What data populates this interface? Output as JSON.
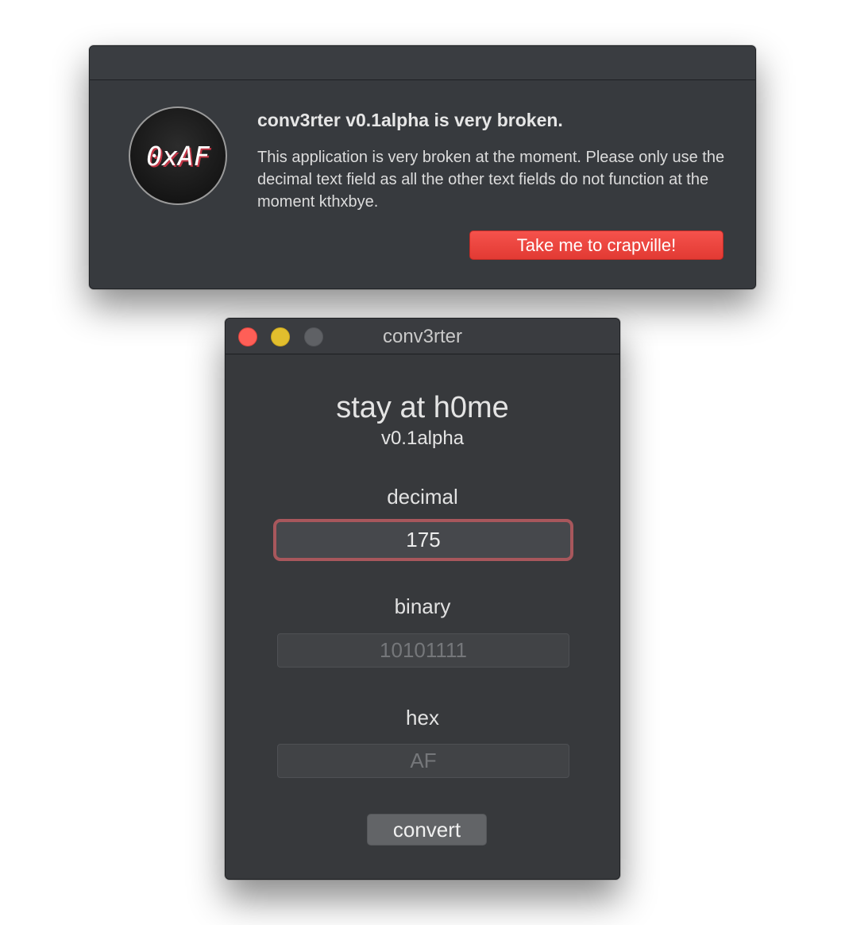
{
  "alert": {
    "icon_text": "0xAF",
    "title": "conv3rter v0.1alpha is very broken.",
    "message": "This application is very broken at the moment. Please only use the decimal text field as all the other text fields do not function at the moment kthxbye.",
    "button_label": "Take me to crapville!",
    "button_color": "#e8413a"
  },
  "window": {
    "title": "conv3rter",
    "controls": {
      "close_color": "#fe5f57",
      "minimize_color": "#e2be2d",
      "zoom_color": "#5f6165"
    }
  },
  "app": {
    "heading": "stay at h0me",
    "version": "v0.1alpha",
    "decimal": {
      "label": "decimal",
      "value": "175",
      "focus_color": "#a8575c"
    },
    "binary": {
      "label": "binary",
      "value": "10101111"
    },
    "hex": {
      "label": "hex",
      "value": "AF"
    },
    "convert_label": "convert"
  }
}
